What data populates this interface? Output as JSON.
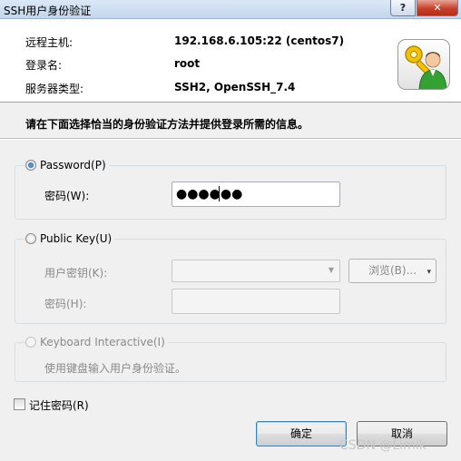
{
  "window": {
    "title": "SSH用户身份验证",
    "help_label": "?",
    "close_label": "✕"
  },
  "header": {
    "remote_host_label": "远程主机:",
    "remote_host_value": "192.168.6.105:22 (centos7)",
    "login_name_label": "登录名:",
    "login_name_value": "root",
    "server_type_label": "服务器类型:",
    "server_type_value": "SSH2, OpenSSH_7.4",
    "avatar_icon": "user-key-icon"
  },
  "instruction": "请在下面选择恰当的身份验证方法并提供登录所需的信息。",
  "password_group": {
    "radio_label": "Password(P)",
    "selected": true,
    "field_label": "密码(W):",
    "field_value": "●●●●●●"
  },
  "publickey_group": {
    "radio_label": "Public Key(U)",
    "selected": false,
    "key_label": "用户密钥(K):",
    "key_value": "",
    "browse_label": "浏览(B)...",
    "passphrase_label": "密码(H):",
    "passphrase_value": ""
  },
  "keyboard_group": {
    "radio_label": "Keyboard Interactive(I)",
    "selected": false,
    "description": "使用键盘输入用户身份验证。"
  },
  "remember": {
    "label": "记住密码(R)",
    "checked": false
  },
  "buttons": {
    "ok_label": "确定",
    "cancel_label": "取消"
  },
  "watermark": "CSDN @Limik",
  "colors": {
    "accent_blue": "#3c7fb1",
    "close_red": "#c7402a",
    "disabled_text": "#8a8a8a"
  }
}
